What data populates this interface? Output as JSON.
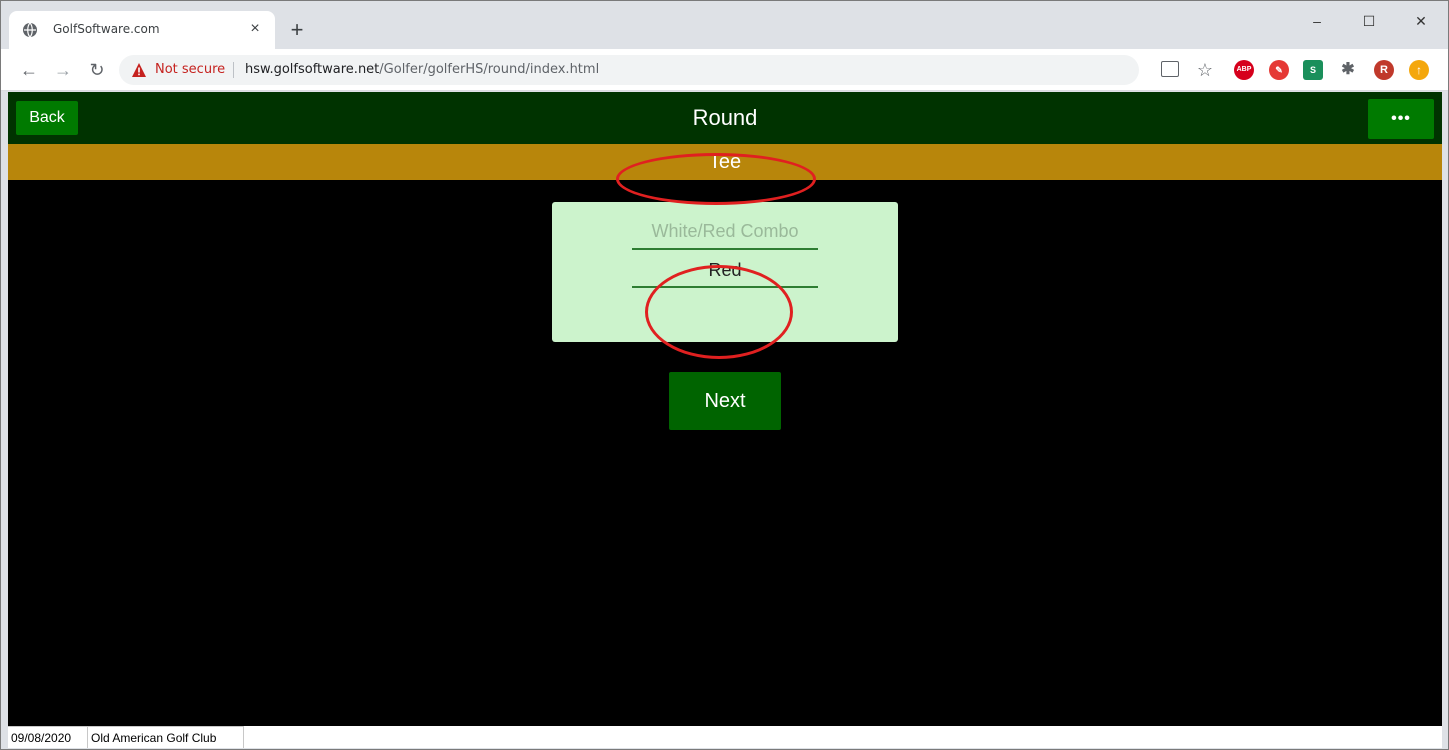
{
  "browser": {
    "tab_title": "GolfSoftware.com",
    "tab_close": "×",
    "new_tab": "+",
    "window_controls": {
      "minimize": "–",
      "maximize": "☐",
      "close": "✕"
    },
    "security_label": "Not secure",
    "url_host": "hsw.golfsoftware.net",
    "url_path": "/Golfer/golferHS/round/index.html",
    "icons": [
      "back-icon",
      "forward-icon",
      "reload-icon",
      "warning-icon",
      "cast-icon",
      "star-icon",
      "adblock-icon",
      "extension-icon",
      "extension-icon",
      "puzzle-icon",
      "profile-icon",
      "update-icon"
    ],
    "profile_initial": "R",
    "abp_label": "ABP"
  },
  "app": {
    "back_label": "Back",
    "title": "Round",
    "more_label": "•••",
    "subtitle": "Tee",
    "header_color": "#003300",
    "subheader_color": "#b8860b",
    "button_color": "#007a00"
  },
  "tee_picker": {
    "options": [
      "White/Red Combo",
      "Red"
    ],
    "selected": "Red"
  },
  "next_label": "Next",
  "status": {
    "date": "09/08/2020",
    "club": "Old American Golf Club"
  }
}
